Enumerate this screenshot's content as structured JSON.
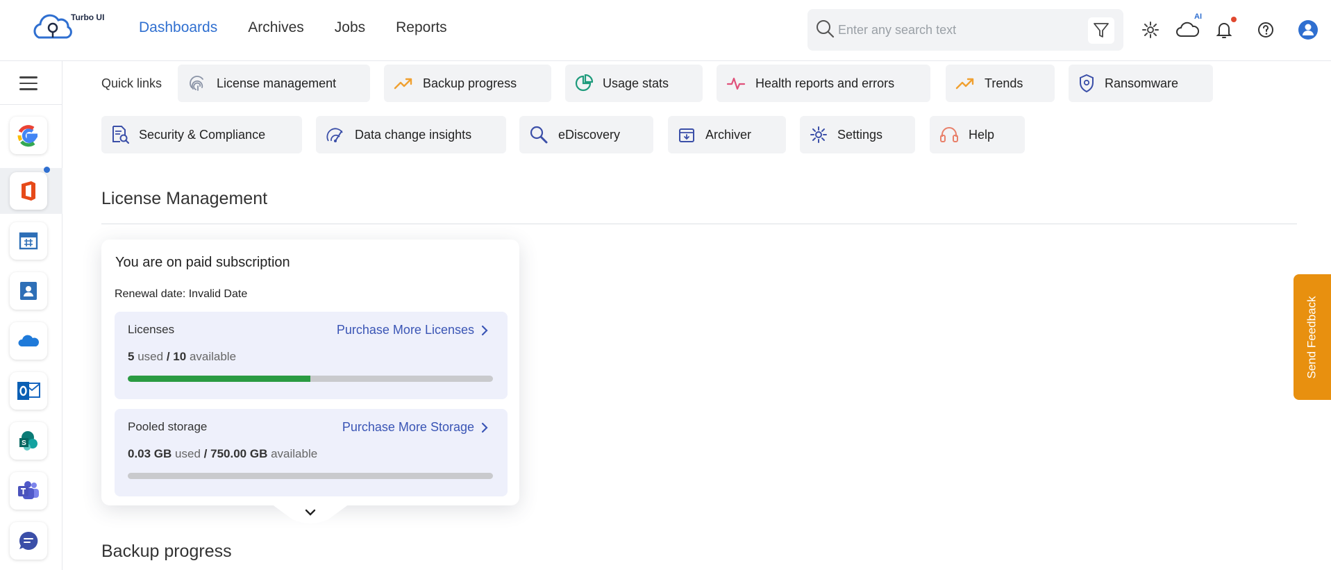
{
  "brand": {
    "name": "Turbo UI"
  },
  "nav": {
    "items": [
      {
        "label": "Dashboards",
        "active": true
      },
      {
        "label": "Archives"
      },
      {
        "label": "Jobs"
      },
      {
        "label": "Reports"
      }
    ]
  },
  "search": {
    "placeholder": "Enter any search text"
  },
  "header": {
    "ai_badge": "AI"
  },
  "sidebar": {
    "apps": [
      "google-app",
      "office365-app",
      "calendar-app",
      "contacts-app",
      "onedrive-app",
      "outlook-app",
      "sharepoint-app",
      "teams-app",
      "chat-app"
    ]
  },
  "quick_links": {
    "label": "Quick links",
    "items": [
      "License management",
      "Backup progress",
      "Usage stats",
      "Health reports and errors",
      "Trends",
      "Ransomware",
      "Security & Compliance",
      "Data change insights",
      "eDiscovery",
      "Archiver",
      "Settings",
      "Help"
    ]
  },
  "license_section": {
    "title": "License Management",
    "card_title": "You are on paid subscription",
    "renewal": "Renewal date: Invalid Date",
    "licenses": {
      "title": "Licenses",
      "link": "Purchase More Licenses",
      "used": "5",
      "used_word": "used",
      "separator": "/",
      "total": "10",
      "available_word": "available",
      "fill_fraction": 0.5
    },
    "storage": {
      "title": "Pooled storage",
      "link": "Purchase More Storage",
      "used": "0.03 GB",
      "used_word": "used",
      "separator": "/",
      "total": "750.00 GB",
      "available_word": "available",
      "fill_fraction": 4e-05
    }
  },
  "backup_section": {
    "title": "Backup progress"
  },
  "feedback": {
    "label": "Send Feedback"
  },
  "colors": {
    "accent": "#2f6fd0",
    "feedback": "#e8900f",
    "progress": "#2a9b42"
  }
}
